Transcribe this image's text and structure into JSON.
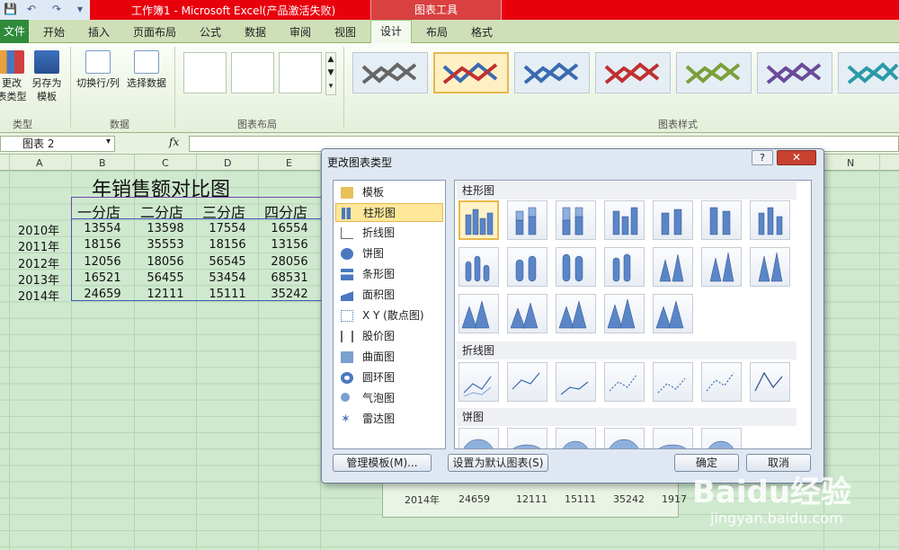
{
  "window": {
    "title": "工作簿1 - Microsoft Excel(产品激活失败)",
    "context_tab": "图表工具"
  },
  "tabs": [
    "文件",
    "开始",
    "插入",
    "页面布局",
    "公式",
    "数据",
    "审阅",
    "视图",
    "设计",
    "布局",
    "格式"
  ],
  "ribbon": {
    "change_type": "更改\n表类型",
    "save_template": "另存为\n模板",
    "switch_row_col": "切换行/列",
    "select_data": "选择数据",
    "groups": [
      "类型",
      "数据",
      "图表布局",
      "图表样式"
    ]
  },
  "formula_bar": {
    "name_box": "图表 2",
    "fx": "fx"
  },
  "columns": [
    "A",
    "B",
    "C",
    "D",
    "E",
    "N"
  ],
  "sheet": {
    "title": "年销售额对比图",
    "stores": [
      "一分店",
      "二分店",
      "三分店",
      "四分店"
    ],
    "rows": [
      {
        "year": "2010年",
        "values": [
          "13554",
          "13598",
          "17554",
          "16554"
        ]
      },
      {
        "year": "2011年",
        "values": [
          "18156",
          "35553",
          "18156",
          "13156"
        ]
      },
      {
        "year": "2012年",
        "values": [
          "12056",
          "18056",
          "56545",
          "28056"
        ]
      },
      {
        "year": "2013年",
        "values": [
          "16521",
          "56455",
          "53454",
          "68531"
        ]
      },
      {
        "year": "2014年",
        "values": [
          "24659",
          "12111",
          "15111",
          "35242"
        ]
      }
    ],
    "chart_table_row": {
      "year": "2014年",
      "values": [
        "24659",
        "12111",
        "15111",
        "35242",
        "1917"
      ]
    }
  },
  "dialog": {
    "title": "更改图表类型",
    "help": "?",
    "close": "✕",
    "types": [
      "模板",
      "柱形图",
      "折线图",
      "饼图",
      "条形图",
      "面积图",
      "X Y (散点图)",
      "股价图",
      "曲面图",
      "圆环图",
      "气泡图",
      "雷达图"
    ],
    "selected_type": "柱形图",
    "sections": [
      "柱形图",
      "折线图",
      "饼图"
    ],
    "buttons": {
      "manage": "管理模板(M)...",
      "set_default": "设置为默认图表(S)",
      "ok": "确定",
      "cancel": "取消"
    }
  },
  "watermark": {
    "brand": "Baidu经验",
    "url": "jingyan.baidu.com"
  }
}
